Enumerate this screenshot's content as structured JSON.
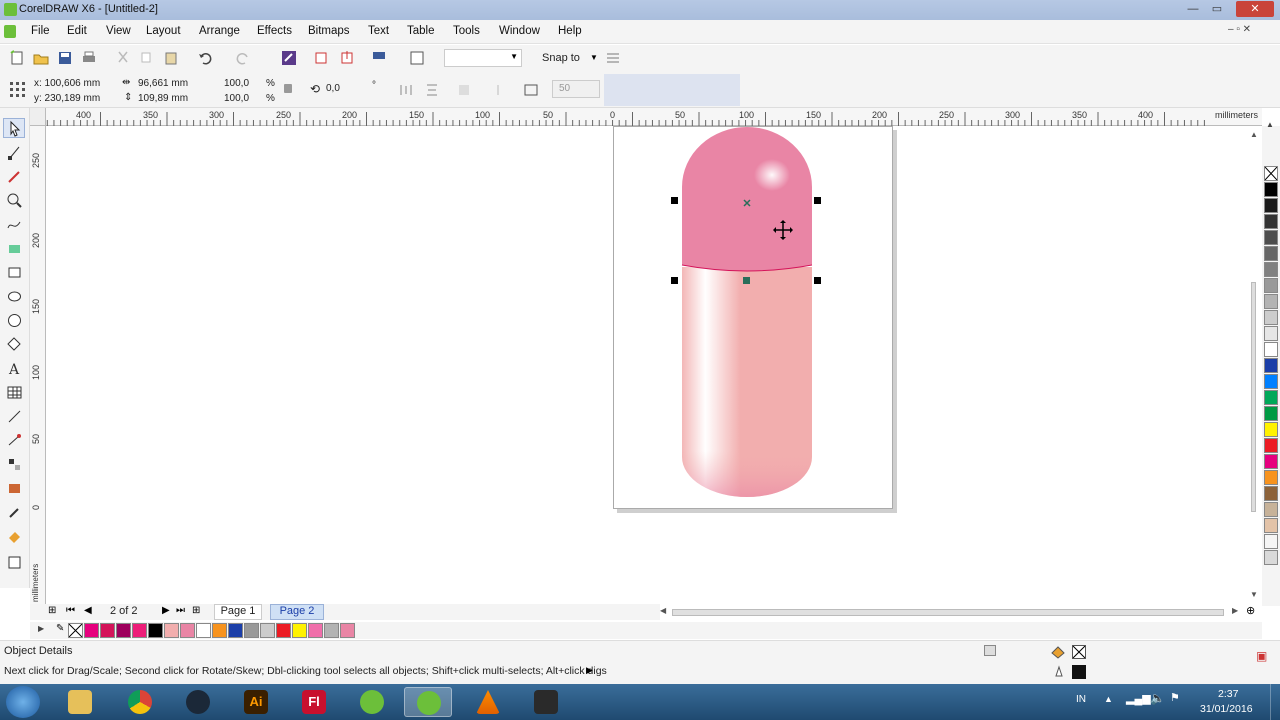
{
  "window": {
    "title": "CorelDRAW X6 - [Untitled-2]",
    "minimize": "—",
    "maximize": "▭",
    "close": "✕"
  },
  "menu": [
    {
      "label": "File"
    },
    {
      "label": "Edit"
    },
    {
      "label": "View"
    },
    {
      "label": "Layout"
    },
    {
      "label": "Arrange"
    },
    {
      "label": "Effects"
    },
    {
      "label": "Bitmaps"
    },
    {
      "label": "Text"
    },
    {
      "label": "Table"
    },
    {
      "label": "Tools"
    },
    {
      "label": "Window"
    },
    {
      "label": "Help"
    }
  ],
  "toolbar": {
    "snap_to": "Snap to",
    "zoom_value": ""
  },
  "properties": {
    "x": "x: 100,606 mm",
    "y": "y: 230,189 mm",
    "width": "96,661 mm",
    "height": "109,89 mm",
    "scale_w": "100,0",
    "scale_h": "100,0",
    "pct": "%",
    "rotation": "0,0",
    "degree": "°",
    "nudge": "50"
  },
  "ruler": {
    "h_labels": [
      "400",
      "350",
      "300",
      "250",
      "200",
      "150",
      "100",
      "50",
      "0",
      "50",
      "100",
      "150",
      "200",
      "250",
      "300",
      "350",
      "400"
    ],
    "v_labels": [
      "250",
      "200",
      "150",
      "100",
      "50",
      "0"
    ],
    "unit": "millimeters"
  },
  "pages": {
    "counter": "2 of 2",
    "tabs": [
      "Page 1",
      "Page 2"
    ],
    "active": 1
  },
  "status": {
    "title": "Object Details",
    "hint": "Next click for Drag/Scale; Second click for Rotate/Skew; Dbl-clicking tool selects all objects; Shift+click multi-selects; Alt+click digs"
  },
  "taskbar": {
    "lang": "IN",
    "time": "2:37",
    "date": "31/01/2016",
    "ai": "Ai",
    "fl": "Fl"
  },
  "colors": {
    "capsule_top": "#e985a5",
    "capsule_bottom": "#f2aeae",
    "palette": [
      "#000000",
      "#1a1a1a",
      "#333333",
      "#4d4d4d",
      "#666666",
      "#808080",
      "#999999",
      "#b3b3b3",
      "#cccccc",
      "#e6e6e6",
      "#ffffff",
      "#1b3ea8",
      "#0080ff",
      "#00a859",
      "#009a44",
      "#fff200",
      "#ec1c24",
      "#e6007e",
      "#f7931e",
      "#8c6239",
      "#c7b299",
      "#e3c3a8",
      "#f5f5f5",
      "#d9d9d9"
    ],
    "doc_palette": [
      "#e6007e",
      "#d4145a",
      "#9e005d",
      "#ed1e79",
      "#000000",
      "#f2aeae",
      "#e985a5",
      "#ffffff",
      "#f7931e",
      "#1b3ea8",
      "#999999",
      "#cccccc",
      "#ec1c24",
      "#fff200",
      "#f06eaa",
      "#b3b3b3",
      "#e985a5"
    ]
  }
}
